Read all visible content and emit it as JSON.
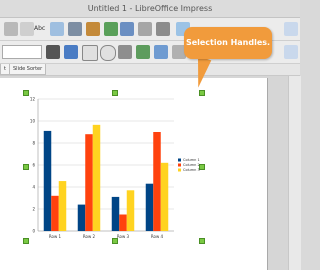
{
  "window": {
    "title": "Untitled 1 - LibreOffice Impress"
  },
  "toolbar": {
    "spellcheck_label": "Abc"
  },
  "tabs": [
    {
      "label": "t"
    },
    {
      "label": "Slide Sorter"
    }
  ],
  "callout": {
    "text": "Selection Handles."
  },
  "colors": {
    "series1": "#004586",
    "series2": "#ff420e",
    "series3": "#ffd320",
    "handle": "#7ac943",
    "callout": "#f19b3c"
  },
  "chart_data": {
    "type": "bar",
    "categories": [
      "Row 1",
      "Row 2",
      "Row 3",
      "Row 4"
    ],
    "series": [
      {
        "name": "Column 1",
        "values": [
          9.1,
          2.4,
          3.1,
          4.3
        ]
      },
      {
        "name": "Column 2",
        "values": [
          3.2,
          8.8,
          1.5,
          9.0
        ]
      },
      {
        "name": "Column 3",
        "values": [
          4.54,
          9.65,
          3.7,
          6.2
        ]
      }
    ],
    "ylim": [
      0,
      12
    ],
    "yticks": [
      0,
      2,
      4,
      6,
      8,
      10,
      12
    ],
    "grid": true,
    "legend": "right"
  }
}
